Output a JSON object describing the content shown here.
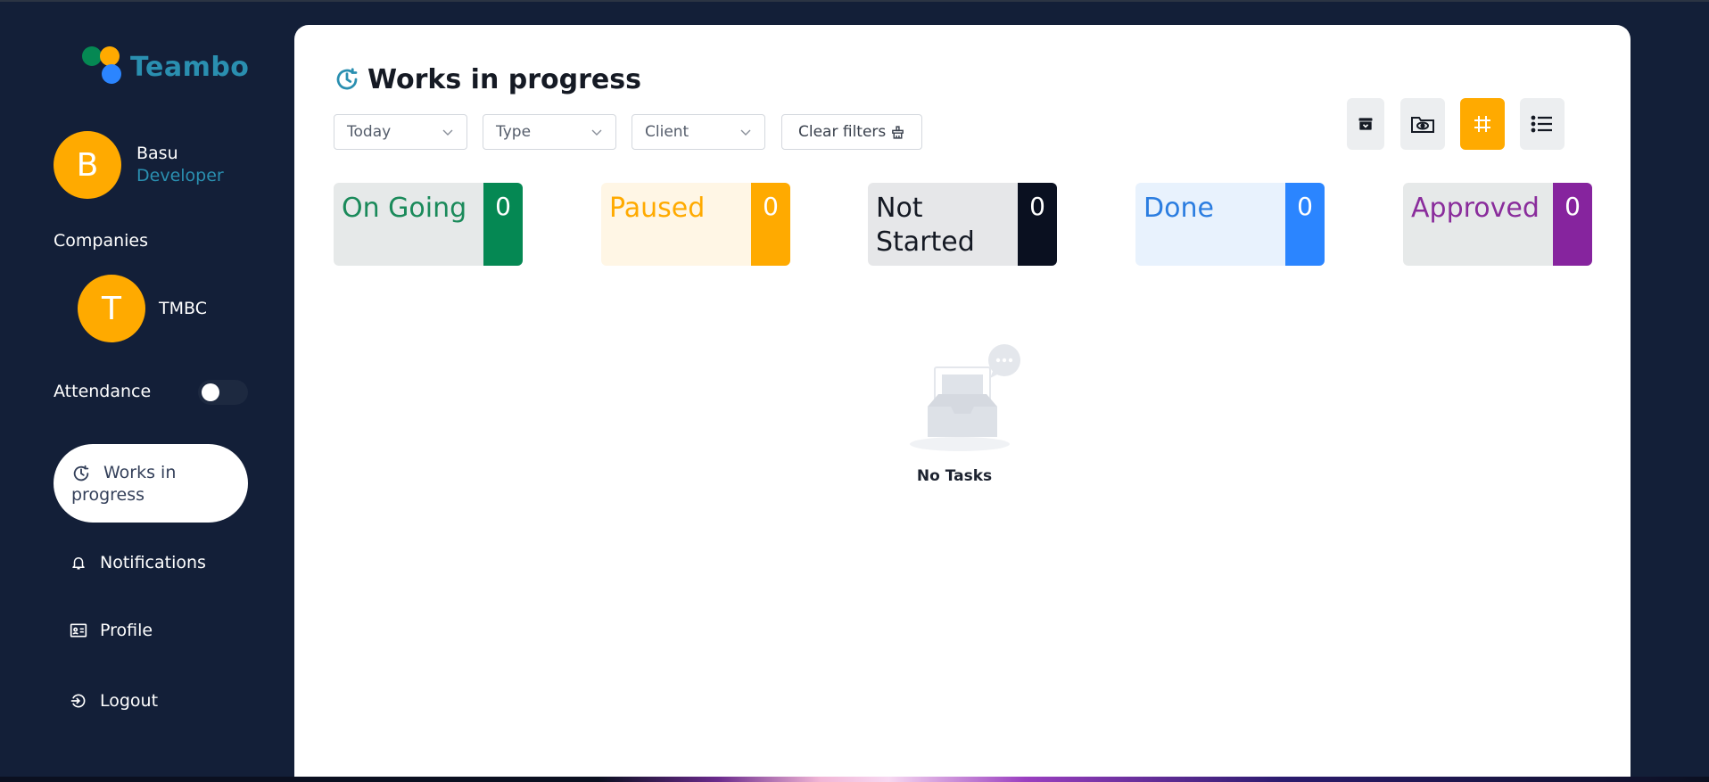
{
  "app": {
    "name": "Teambo"
  },
  "user": {
    "initial": "B",
    "name": "Basu",
    "role": "Developer"
  },
  "companies": {
    "label": "Companies",
    "items": [
      {
        "initial": "T",
        "name": "TMBC"
      }
    ]
  },
  "attendance": {
    "label": "Attendance",
    "on": false
  },
  "nav": {
    "active": {
      "label": "Works in progress",
      "icon": "clock-icon"
    },
    "items": [
      {
        "label": "Notifications",
        "icon": "bell-icon"
      },
      {
        "label": "Profile",
        "icon": "id-card-icon"
      },
      {
        "label": "Logout",
        "icon": "logout-icon"
      }
    ]
  },
  "page": {
    "title": "Works in progress"
  },
  "filters": {
    "date": "Today",
    "type": "Type",
    "client": "Client",
    "clear_label": "Clear filters"
  },
  "view_buttons": [
    {
      "icon": "archive-icon",
      "active": false
    },
    {
      "icon": "folder-eye-icon",
      "active": false
    },
    {
      "icon": "grid-hash-icon",
      "active": true
    },
    {
      "icon": "list-icon",
      "active": false
    }
  ],
  "status_cards": [
    {
      "label": "On Going",
      "count": "0",
      "text_color": "#1a8a5a",
      "bg": "#e6e9e9",
      "badge": "#058853"
    },
    {
      "label": "Paused",
      "count": "0",
      "text_color": "#ffaa00",
      "bg": "#fff6e5",
      "badge": "#ffaa00"
    },
    {
      "label": "Not Started",
      "count": "0",
      "text_color": "#151a24",
      "bg": "#e6e7e9",
      "badge": "#0a1020"
    },
    {
      "label": "Done",
      "count": "0",
      "text_color": "#2b7de0",
      "bg": "#e8f2fd",
      "badge": "#2b85ff"
    },
    {
      "label": "Approved",
      "count": "0",
      "text_color": "#8a2d9c",
      "bg": "#e6e9e9",
      "badge": "#86249e"
    }
  ],
  "empty_state": {
    "text": "No Tasks"
  },
  "colors": {
    "sidebar": "#131f38",
    "accent": "#ffaa00",
    "brand_text": "#2a8fb0"
  }
}
